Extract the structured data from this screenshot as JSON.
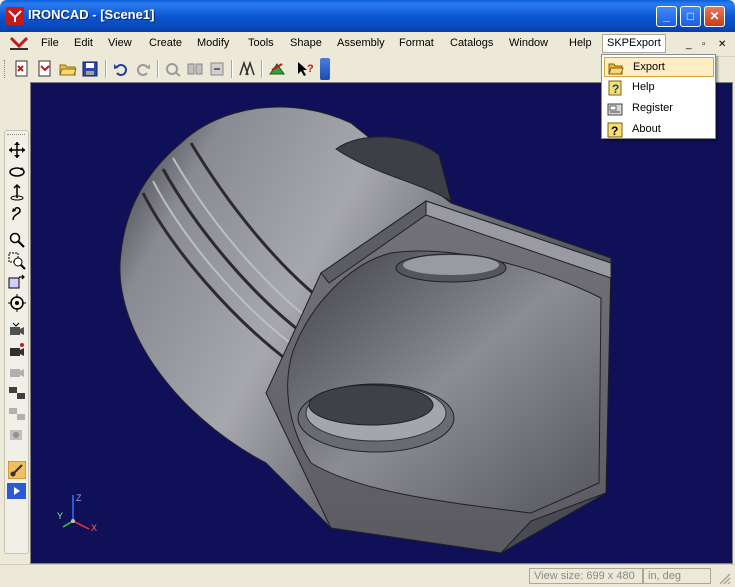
{
  "window": {
    "title": "IRONCAD - [Scene1]",
    "minimize_glyph": "_",
    "maximize_glyph": "□",
    "close_glyph": "✕"
  },
  "menubar": {
    "items": [
      "File",
      "Edit",
      "View",
      "Create",
      "Modify",
      "Tools",
      "Shape",
      "Assembly",
      "Format",
      "Catalogs",
      "Window",
      "Help",
      "SKPExport"
    ],
    "mdi_controls": [
      "_",
      "▫",
      "✕"
    ]
  },
  "dropdown": {
    "items": [
      {
        "label": "Export",
        "icon": "folder-open-icon"
      },
      {
        "label": "Help",
        "icon": "help-icon"
      },
      {
        "label": "Register",
        "icon": "register-icon"
      },
      {
        "label": "About",
        "icon": "about-icon"
      }
    ]
  },
  "toolbar": {
    "icons": [
      "new-icon",
      "open-icon",
      "folder-icon",
      "save-icon",
      "undo-icon",
      "redo-icon",
      "tool-icon",
      "tool-icon",
      "tool-icon",
      "tool-icon",
      "tool-icon",
      "context-help-icon"
    ]
  },
  "left_toolbar": {
    "icons": [
      "move-icon",
      "orbit-icon",
      "pan-icon",
      "walk-icon",
      "zoom-icon",
      "zoom-window-icon",
      "zoom-fit-icon",
      "target-icon",
      "camera-icon",
      "camera-icon",
      "camera-icon",
      "camera-icon",
      "camera-icon",
      "camera-icon",
      "render-icon"
    ]
  },
  "viewport": {
    "background": "#101058",
    "triad": {
      "x": "X",
      "y": "Y",
      "z": "Z"
    }
  },
  "statusbar": {
    "view_size": "View size:  699 x 480",
    "units": "in, deg"
  },
  "colors": {
    "title_blue": "#0b58d3",
    "menu_bg": "#ece9d8",
    "highlight": "#ffeec2",
    "highlight_border": "#d7a23a"
  }
}
